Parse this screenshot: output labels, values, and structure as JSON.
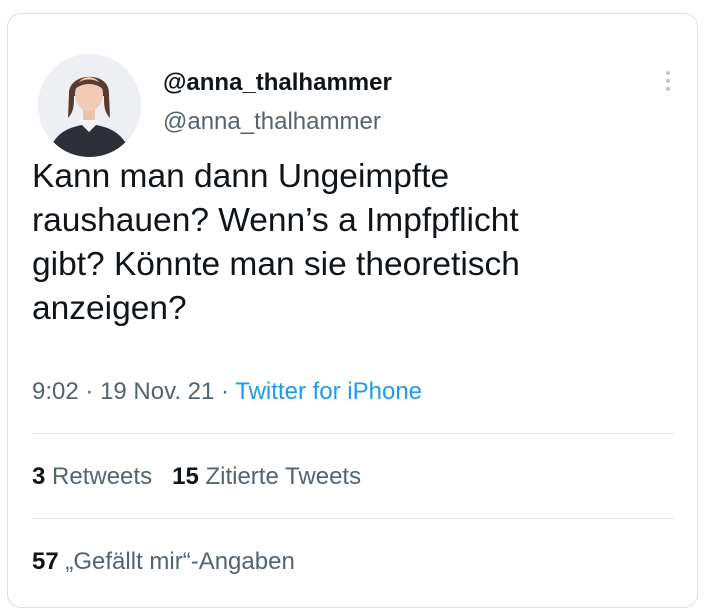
{
  "profile": {
    "display_name": "@anna_thalhammer",
    "handle": "@anna_thalhammer"
  },
  "tweet": {
    "text": "Kann man dann Ungeimpfte\nraushauen? Wenn’s a Impfpflicht\ngibt? Könnte man sie theoretisch\nanzeigen?",
    "time": "9:02",
    "separator": "·",
    "date": "19 Nov. 21",
    "source": "Twitter for iPhone"
  },
  "stats": {
    "retweets_count": "3",
    "retweets_label": "Retweets",
    "quotes_count": "15",
    "quotes_label": "Zitierte Tweets",
    "likes_count": "57",
    "likes_label": "„Gefällt mir“-Angaben"
  },
  "colors": {
    "text": "#0f1419",
    "secondary": "#536471",
    "link": "#1d9bf0",
    "border": "#dcdfe3"
  },
  "icons": {
    "more": "more-vertical-icon"
  }
}
